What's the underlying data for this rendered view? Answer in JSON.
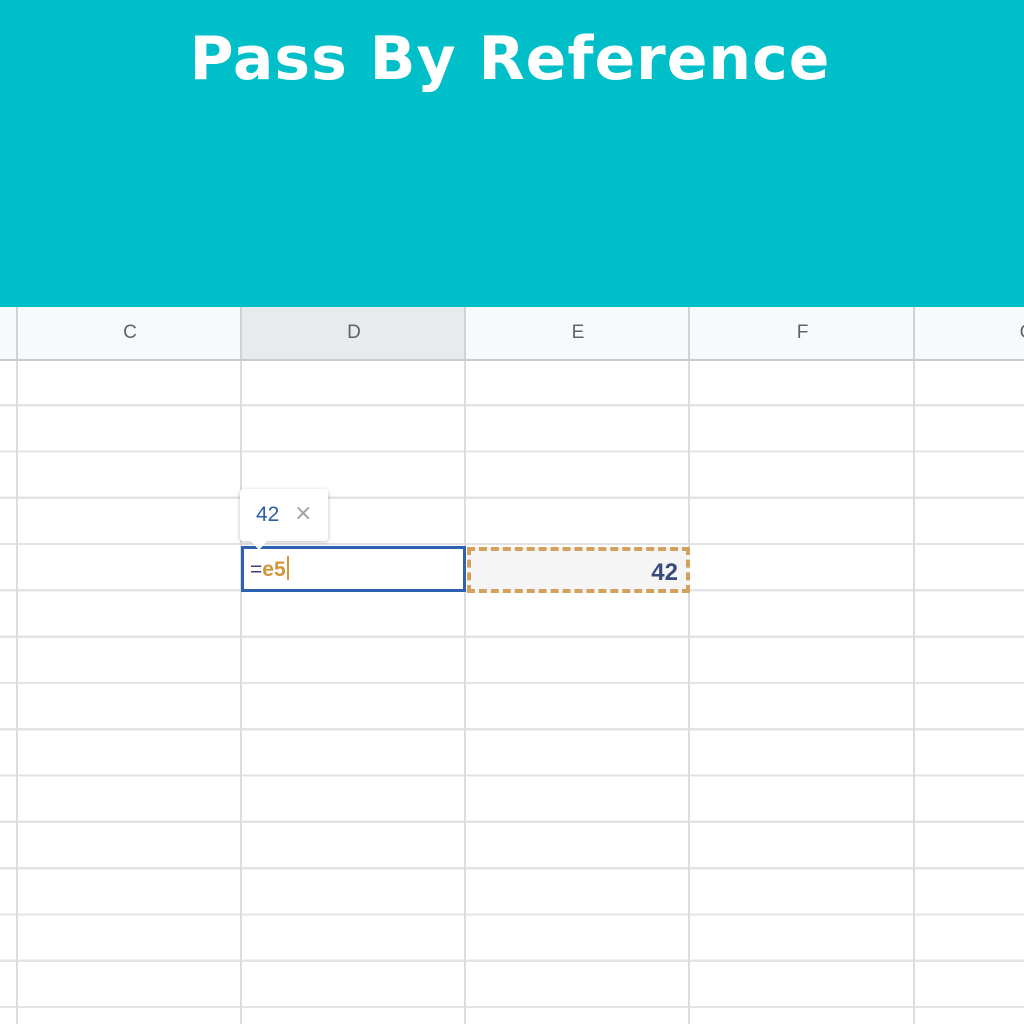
{
  "banner": {
    "title": "Pass By Reference",
    "color": "#00bfc8"
  },
  "sheet": {
    "columns": [
      "C",
      "D",
      "E",
      "F",
      "G"
    ],
    "active_column": "D",
    "editor": {
      "equals": "=",
      "reference": "e5",
      "border_color": "#2d62b0",
      "reference_color": "#d1963a"
    },
    "referenced_cell": {
      "value": "42",
      "border_color": "#d4a15c"
    },
    "tooltip": {
      "value": "42",
      "close_icon": "close-icon"
    }
  }
}
